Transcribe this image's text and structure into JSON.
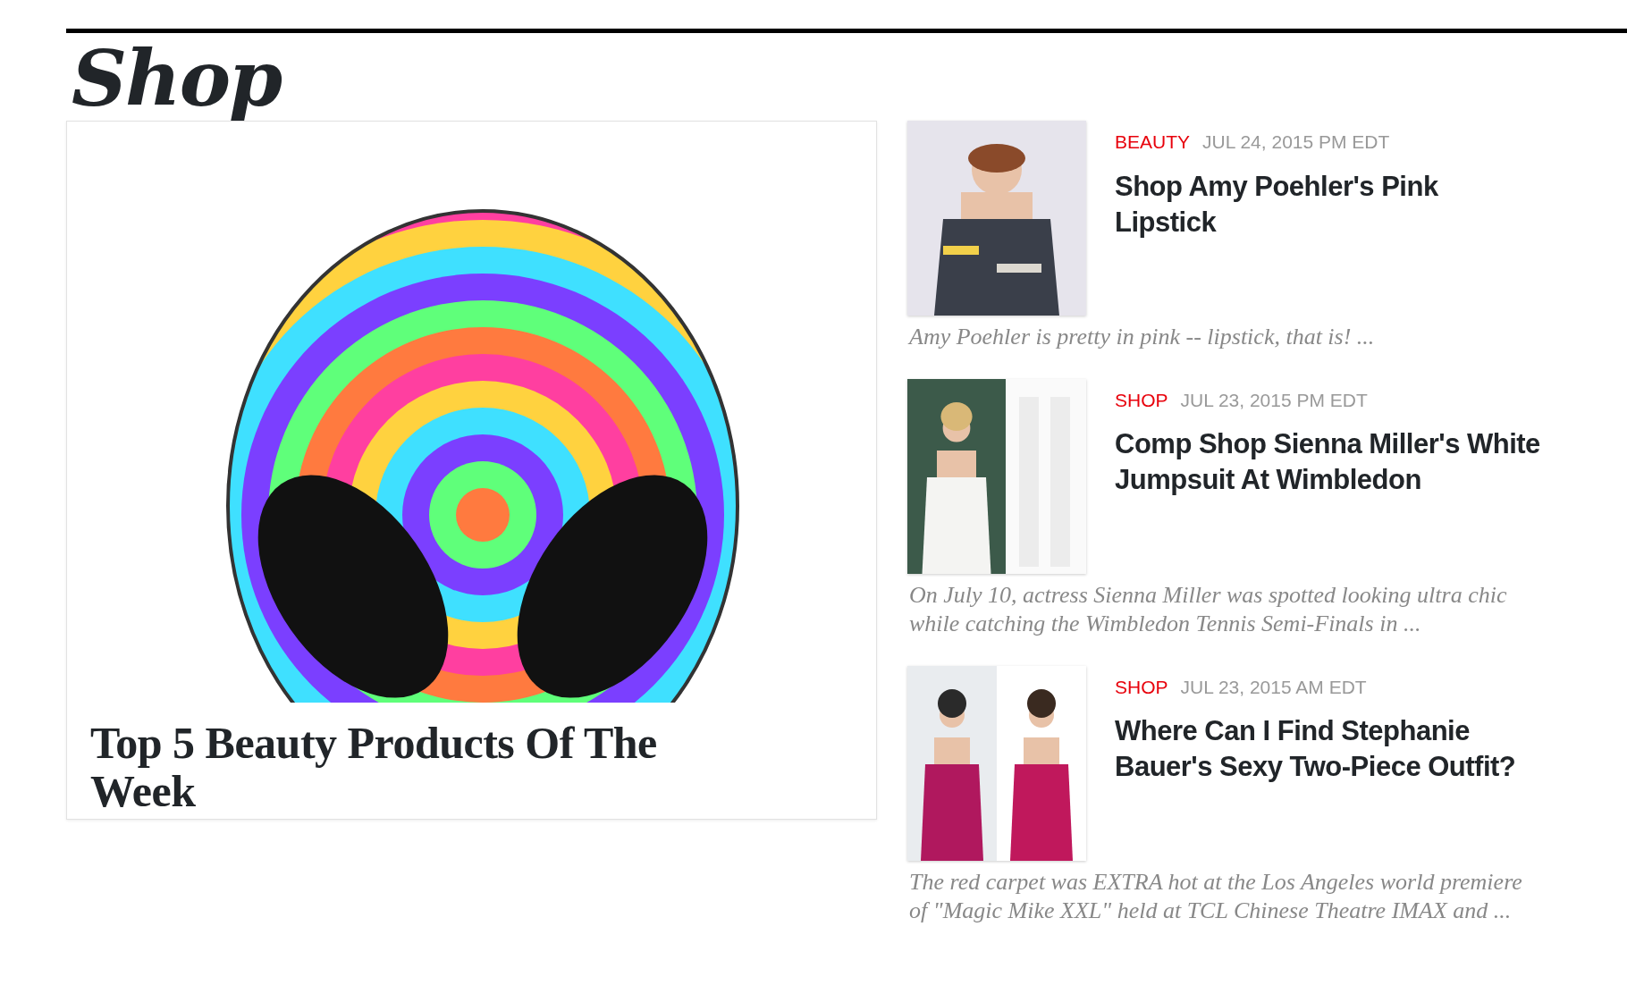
{
  "section_title": "Shop",
  "featured": {
    "title": "Top 5 Beauty Products Of The Week"
  },
  "articles": [
    {
      "category": "BEAUTY",
      "date": "JUL 24, 2015 PM EDT",
      "title": "Shop Amy Poehler's Pink Lipstick",
      "excerpt": "Amy Poehler is pretty in pink -- lipstick, that is! ..."
    },
    {
      "category": "SHOP",
      "date": "JUL 23, 2015 PM EDT",
      "title": "Comp Shop Sienna Miller's White Jumpsuit At Wimbledon",
      "excerpt": "On July 10, actress Sienna Miller was spotted looking ultra chic while catching the Wimbledon Tennis Semi-Finals in ..."
    },
    {
      "category": "SHOP",
      "date": "JUL 23, 2015 AM EDT",
      "title": "Where Can I Find Stephanie Bauer's Sexy Two-Piece Outfit?",
      "excerpt": "The red carpet was EXTRA hot at the Los Angeles world premiere of \"Magic Mike XXL\" held at TCL Chinese Theatre IMAX and ..."
    }
  ]
}
